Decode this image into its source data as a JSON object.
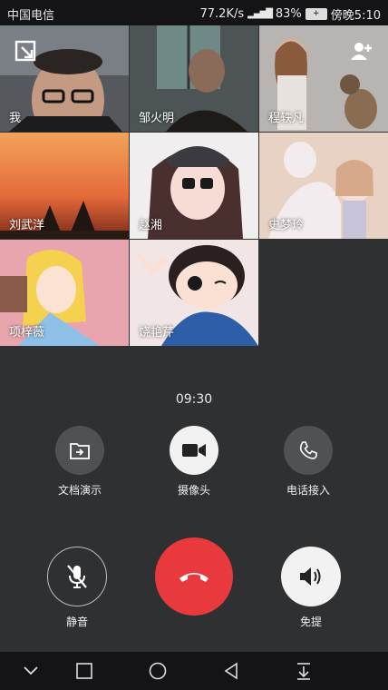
{
  "status": {
    "carrier": "中国电信",
    "speed": "77.2K/s",
    "battery": "83%",
    "time": "傍晚5:10"
  },
  "participants": [
    {
      "name": "我"
    },
    {
      "name": "邹火明"
    },
    {
      "name": "程轶凡"
    },
    {
      "name": "刘武洋"
    },
    {
      "name": "赵湘"
    },
    {
      "name": "史梦玲"
    },
    {
      "name": "项梓薇"
    },
    {
      "name": "饶艳芹"
    }
  ],
  "timer": "09:30",
  "controls_top": [
    {
      "label": "文档演示",
      "icon": "share-document-icon"
    },
    {
      "label": "摄像头",
      "icon": "camera-icon"
    },
    {
      "label": "电话接入",
      "icon": "phone-icon"
    }
  ],
  "controls_bottom": [
    {
      "label": "静音",
      "icon": "mic-muted-icon"
    },
    {
      "label": "",
      "icon": "hang-up-icon"
    },
    {
      "label": "免提",
      "icon": "speaker-icon"
    }
  ],
  "colors": {
    "hangup": "#e8393d",
    "background": "#2f3032",
    "button": "#505153"
  }
}
